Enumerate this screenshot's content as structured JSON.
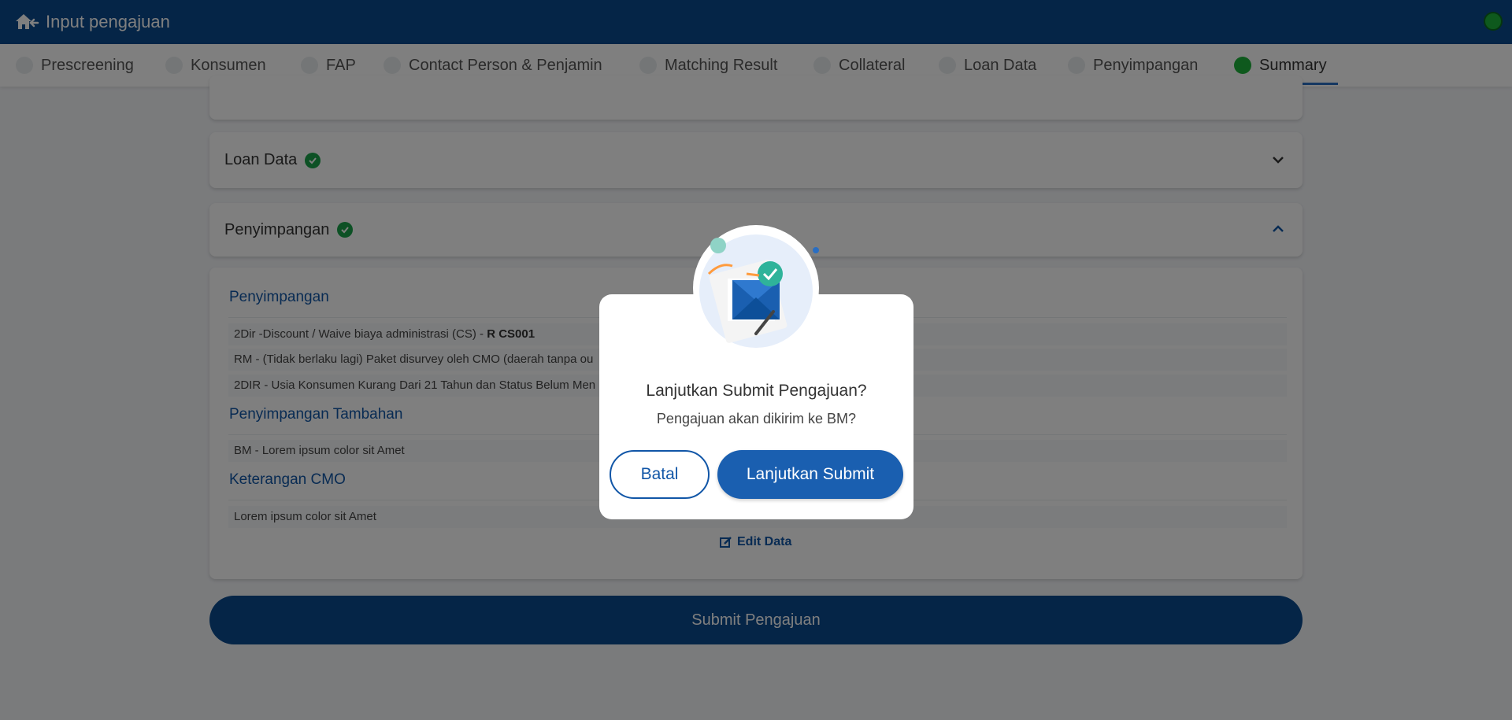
{
  "header": {
    "title": "Input pengajuan"
  },
  "stepper": {
    "steps": [
      {
        "label": "Prescreening"
      },
      {
        "label": "Konsumen"
      },
      {
        "label": "FAP"
      },
      {
        "label": "Contact Person & Penjamin"
      },
      {
        "label": "Matching Result"
      },
      {
        "label": "Collateral"
      },
      {
        "label": "Loan Data"
      },
      {
        "label": "Penyimpangan"
      },
      {
        "label": "Summary"
      }
    ],
    "active": "Summary"
  },
  "sections": {
    "loan_data": {
      "title": "Loan Data"
    },
    "penyimpangan": {
      "title": "Penyimpangan"
    }
  },
  "body": {
    "penyimpangan_title": "Penyimpangan",
    "penyimpangan_rows": [
      {
        "text": "2Dir -Discount / Waive biaya administrasi (CS) - ",
        "code": "R CS001"
      },
      {
        "text": "RM - (Tidak berlaku lagi) Paket disurvey oleh CMO (daerah tanpa ou"
      },
      {
        "text": "2DIR - Usia Konsumen Kurang Dari 21 Tahun dan Status Belum Men"
      }
    ],
    "tambahan_title": "Penyimpangan Tambahan",
    "tambahan_rows": [
      {
        "text": "BM - Lorem ipsum color sit Amet"
      }
    ],
    "cmo_title": "Keterangan CMO",
    "cmo_rows": [
      {
        "text": "Lorem ipsum color sit Amet"
      }
    ],
    "edit_label": "Edit Data"
  },
  "submit_label": "Submit Pengajuan",
  "modal": {
    "title": "Lanjutkan Submit Pengajuan?",
    "subtitle": "Pengajuan akan dikirim ke BM?",
    "cancel_label": "Batal",
    "confirm_label": "Lanjutkan Submit"
  },
  "colors": {
    "primary": "#0a4a8f",
    "accent": "#1a5fb0",
    "success": "#1db33a"
  }
}
